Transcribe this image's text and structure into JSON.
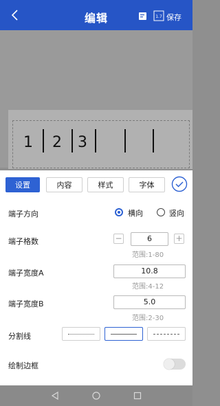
{
  "header": {
    "title": "编辑",
    "save_label": "保存"
  },
  "preview": {
    "chars": [
      "1",
      "2",
      "3"
    ]
  },
  "tabs": [
    {
      "label": "设置",
      "active": true
    },
    {
      "label": "内容",
      "active": false
    },
    {
      "label": "样式",
      "active": false
    },
    {
      "label": "字体",
      "active": false
    }
  ],
  "direction": {
    "label": "端子方向",
    "options": [
      "横向",
      "竖向"
    ],
    "selected": "横向"
  },
  "grid_count": {
    "label": "端子格数",
    "value": "6",
    "minus": "−",
    "plus": "+",
    "range": "范围:1-80"
  },
  "width_a": {
    "label": "端子宽度A",
    "value": "10.8",
    "range": "范围:4-12"
  },
  "width_b": {
    "label": "端子宽度B",
    "value": "5.0",
    "range": "范围:2-30"
  },
  "divider": {
    "label": "分割线",
    "styles": [
      "dotted",
      "solid",
      "dashed"
    ],
    "selected_index": 1
  },
  "draw_border": {
    "label": "绘制边框",
    "enabled": false
  },
  "colors": {
    "primary": "#2e62d3",
    "header": "#2655c6"
  }
}
